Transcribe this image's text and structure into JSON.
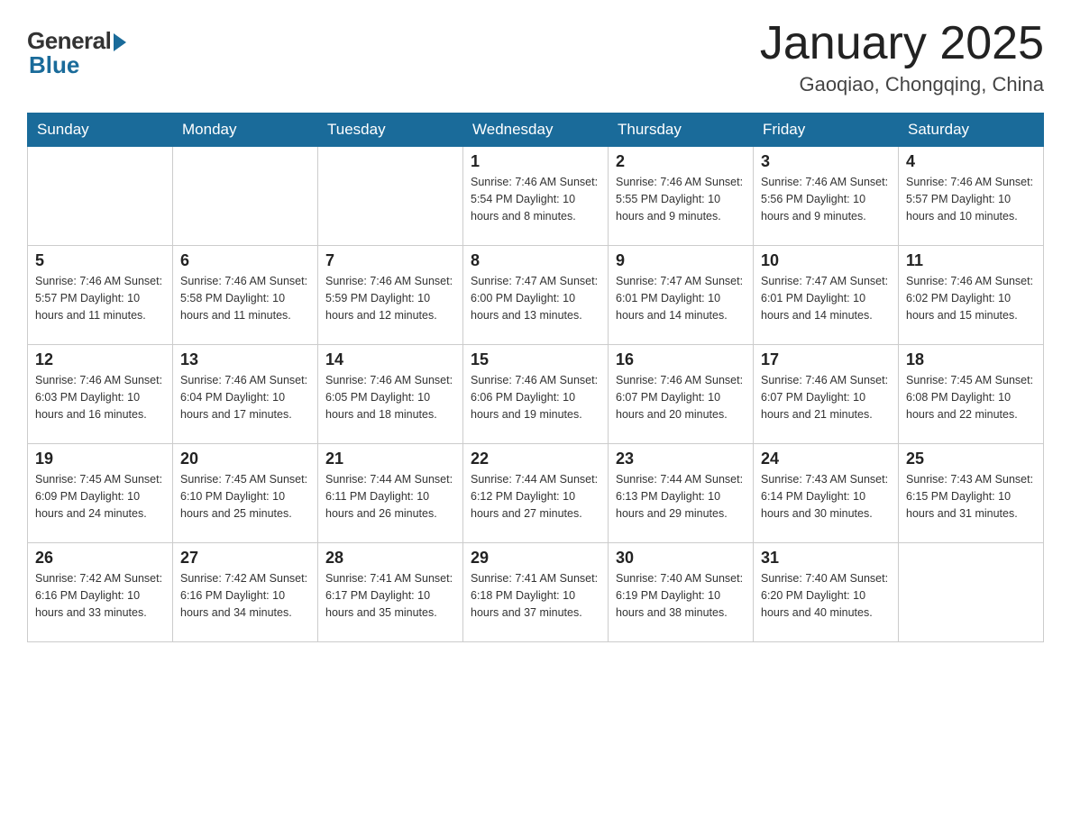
{
  "header": {
    "title": "January 2025",
    "location": "Gaoqiao, Chongqing, China",
    "logo_general": "General",
    "logo_blue": "Blue"
  },
  "days_of_week": [
    "Sunday",
    "Monday",
    "Tuesday",
    "Wednesday",
    "Thursday",
    "Friday",
    "Saturday"
  ],
  "weeks": [
    [
      {
        "day": "",
        "info": ""
      },
      {
        "day": "",
        "info": ""
      },
      {
        "day": "",
        "info": ""
      },
      {
        "day": "1",
        "info": "Sunrise: 7:46 AM\nSunset: 5:54 PM\nDaylight: 10 hours\nand 8 minutes."
      },
      {
        "day": "2",
        "info": "Sunrise: 7:46 AM\nSunset: 5:55 PM\nDaylight: 10 hours\nand 9 minutes."
      },
      {
        "day": "3",
        "info": "Sunrise: 7:46 AM\nSunset: 5:56 PM\nDaylight: 10 hours\nand 9 minutes."
      },
      {
        "day": "4",
        "info": "Sunrise: 7:46 AM\nSunset: 5:57 PM\nDaylight: 10 hours\nand 10 minutes."
      }
    ],
    [
      {
        "day": "5",
        "info": "Sunrise: 7:46 AM\nSunset: 5:57 PM\nDaylight: 10 hours\nand 11 minutes."
      },
      {
        "day": "6",
        "info": "Sunrise: 7:46 AM\nSunset: 5:58 PM\nDaylight: 10 hours\nand 11 minutes."
      },
      {
        "day": "7",
        "info": "Sunrise: 7:46 AM\nSunset: 5:59 PM\nDaylight: 10 hours\nand 12 minutes."
      },
      {
        "day": "8",
        "info": "Sunrise: 7:47 AM\nSunset: 6:00 PM\nDaylight: 10 hours\nand 13 minutes."
      },
      {
        "day": "9",
        "info": "Sunrise: 7:47 AM\nSunset: 6:01 PM\nDaylight: 10 hours\nand 14 minutes."
      },
      {
        "day": "10",
        "info": "Sunrise: 7:47 AM\nSunset: 6:01 PM\nDaylight: 10 hours\nand 14 minutes."
      },
      {
        "day": "11",
        "info": "Sunrise: 7:46 AM\nSunset: 6:02 PM\nDaylight: 10 hours\nand 15 minutes."
      }
    ],
    [
      {
        "day": "12",
        "info": "Sunrise: 7:46 AM\nSunset: 6:03 PM\nDaylight: 10 hours\nand 16 minutes."
      },
      {
        "day": "13",
        "info": "Sunrise: 7:46 AM\nSunset: 6:04 PM\nDaylight: 10 hours\nand 17 minutes."
      },
      {
        "day": "14",
        "info": "Sunrise: 7:46 AM\nSunset: 6:05 PM\nDaylight: 10 hours\nand 18 minutes."
      },
      {
        "day": "15",
        "info": "Sunrise: 7:46 AM\nSunset: 6:06 PM\nDaylight: 10 hours\nand 19 minutes."
      },
      {
        "day": "16",
        "info": "Sunrise: 7:46 AM\nSunset: 6:07 PM\nDaylight: 10 hours\nand 20 minutes."
      },
      {
        "day": "17",
        "info": "Sunrise: 7:46 AM\nSunset: 6:07 PM\nDaylight: 10 hours\nand 21 minutes."
      },
      {
        "day": "18",
        "info": "Sunrise: 7:45 AM\nSunset: 6:08 PM\nDaylight: 10 hours\nand 22 minutes."
      }
    ],
    [
      {
        "day": "19",
        "info": "Sunrise: 7:45 AM\nSunset: 6:09 PM\nDaylight: 10 hours\nand 24 minutes."
      },
      {
        "day": "20",
        "info": "Sunrise: 7:45 AM\nSunset: 6:10 PM\nDaylight: 10 hours\nand 25 minutes."
      },
      {
        "day": "21",
        "info": "Sunrise: 7:44 AM\nSunset: 6:11 PM\nDaylight: 10 hours\nand 26 minutes."
      },
      {
        "day": "22",
        "info": "Sunrise: 7:44 AM\nSunset: 6:12 PM\nDaylight: 10 hours\nand 27 minutes."
      },
      {
        "day": "23",
        "info": "Sunrise: 7:44 AM\nSunset: 6:13 PM\nDaylight: 10 hours\nand 29 minutes."
      },
      {
        "day": "24",
        "info": "Sunrise: 7:43 AM\nSunset: 6:14 PM\nDaylight: 10 hours\nand 30 minutes."
      },
      {
        "day": "25",
        "info": "Sunrise: 7:43 AM\nSunset: 6:15 PM\nDaylight: 10 hours\nand 31 minutes."
      }
    ],
    [
      {
        "day": "26",
        "info": "Sunrise: 7:42 AM\nSunset: 6:16 PM\nDaylight: 10 hours\nand 33 minutes."
      },
      {
        "day": "27",
        "info": "Sunrise: 7:42 AM\nSunset: 6:16 PM\nDaylight: 10 hours\nand 34 minutes."
      },
      {
        "day": "28",
        "info": "Sunrise: 7:41 AM\nSunset: 6:17 PM\nDaylight: 10 hours\nand 35 minutes."
      },
      {
        "day": "29",
        "info": "Sunrise: 7:41 AM\nSunset: 6:18 PM\nDaylight: 10 hours\nand 37 minutes."
      },
      {
        "day": "30",
        "info": "Sunrise: 7:40 AM\nSunset: 6:19 PM\nDaylight: 10 hours\nand 38 minutes."
      },
      {
        "day": "31",
        "info": "Sunrise: 7:40 AM\nSunset: 6:20 PM\nDaylight: 10 hours\nand 40 minutes."
      },
      {
        "day": "",
        "info": ""
      }
    ]
  ]
}
